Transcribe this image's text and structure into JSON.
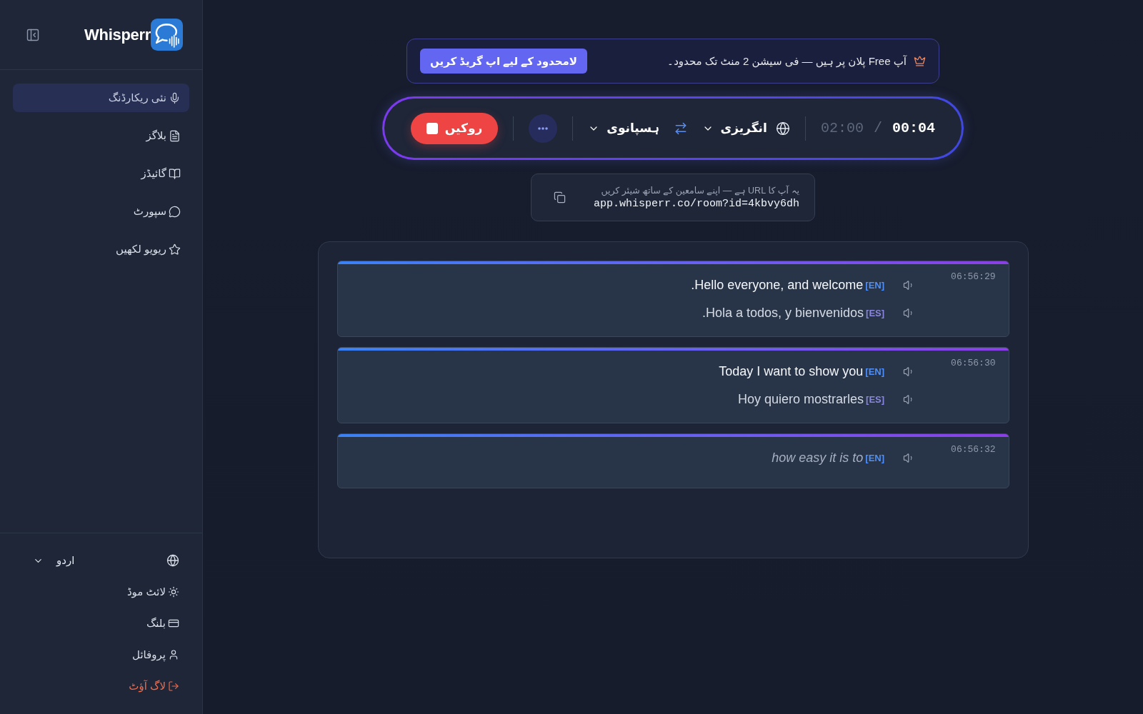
{
  "sidebar": {
    "logo": "Whisperr",
    "nav": [
      {
        "label": "نئی ریکارڈنگ",
        "selected": true
      },
      {
        "label": "بلاگز",
        "selected": false
      },
      {
        "label": "گائیڈز",
        "selected": false
      },
      {
        "label": "سپورٹ",
        "selected": false
      },
      {
        "label": "ریویو لکھیں",
        "selected": false
      }
    ],
    "language": {
      "value": "اردو"
    },
    "footer_links": [
      {
        "label": "لائٹ موڈ",
        "kind": "normal"
      },
      {
        "label": "بلنگ",
        "kind": "normal"
      },
      {
        "label": "پروفائل",
        "kind": "normal"
      },
      {
        "label": "لاگ آؤٹ",
        "kind": "danger"
      }
    ]
  },
  "plan_banner": {
    "message": "آپ Free پلان پر ہیں — فی سیشن 2 منٹ تک محدود۔",
    "button": "لامحدود کے لیے اپ گریڈ کریں"
  },
  "recorder": {
    "recording": true,
    "elapsed": "00:04",
    "separator": "/",
    "limit": "02:00",
    "source_language": "انگریزی",
    "target_language": "ہسپانوی",
    "stop_button": "روکیں"
  },
  "share": {
    "hint": "یہ آپ کا URL ہے — اپنے سامعین کے ساتھ شیئر کریں",
    "url": "app.whisperr.co/room?id=4kbvy6dh"
  },
  "transcript": [
    {
      "time": "06:56:29",
      "interim": false,
      "lines": [
        {
          "kind": "source",
          "text": "Hello everyone, and welcome.",
          "tag": "[EN]"
        },
        {
          "kind": "translation",
          "text": "Hola a todos, y bienvenidos.",
          "tag": "[ES]"
        }
      ]
    },
    {
      "time": "06:56:30",
      "interim": false,
      "lines": [
        {
          "kind": "source",
          "text": "Today I want to show you",
          "tag": "[EN]"
        },
        {
          "kind": "translation",
          "text": "Hoy quiero mostrarles",
          "tag": "[ES]"
        }
      ]
    },
    {
      "time": "06:56:32",
      "interim": true,
      "lines": [
        {
          "kind": "source",
          "text": "how easy it is to",
          "tag": "[EN]"
        }
      ]
    }
  ]
}
